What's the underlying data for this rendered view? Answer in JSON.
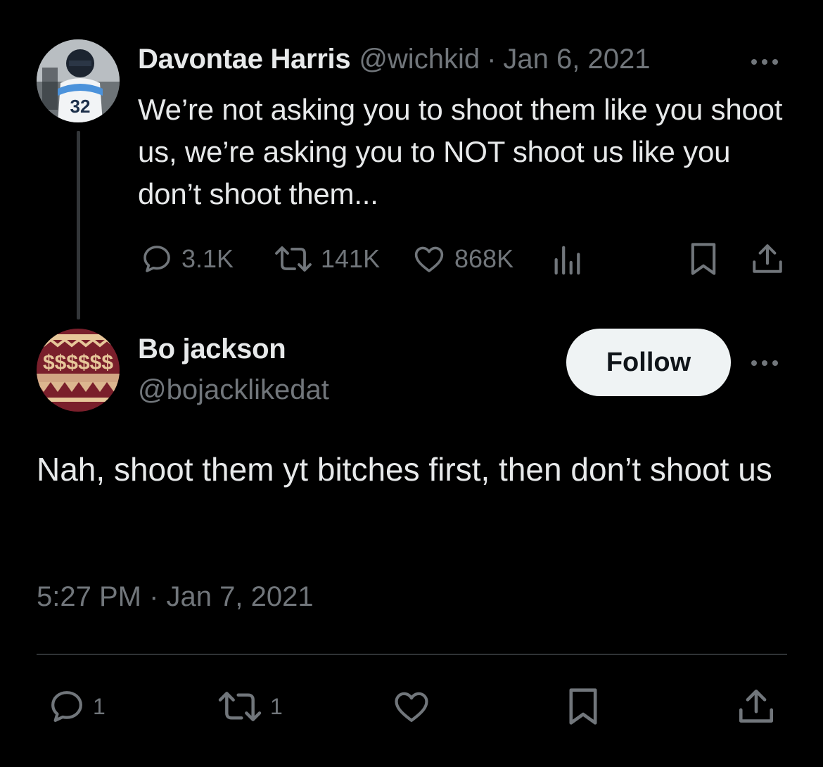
{
  "parent_tweet": {
    "author_name": "Davontae Harris",
    "handle": "@wichkid",
    "separator": "·",
    "date": "Jan 6, 2021",
    "text": "We’re not asking you to shoot them like you shoot us, we’re asking you to NOT shoot us like you don’t shoot them...",
    "stats": {
      "replies": "3.1K",
      "retweets": "141K",
      "likes": "868K"
    },
    "avatar_jersey_number": "32"
  },
  "reply_tweet": {
    "author_name": "Bo jackson",
    "handle": "@bojacklikedat",
    "follow_label": "Follow",
    "text": "Nah, shoot them yt bitches first, then don’t shoot us",
    "timestamp": "5:27 PM · Jan 7, 2021",
    "stats": {
      "replies": "1",
      "retweets": "1"
    }
  },
  "icons": {
    "reply": "reply-icon",
    "retweet": "retweet-icon",
    "like": "heart-icon",
    "views": "views-icon",
    "bookmark": "bookmark-icon",
    "share": "share-icon",
    "more": "more-icon"
  },
  "colors": {
    "background": "#000000",
    "text_primary": "#e7e9ea",
    "text_muted": "#71767b",
    "follow_bg": "#eff3f4",
    "divider": "#2f3336"
  }
}
